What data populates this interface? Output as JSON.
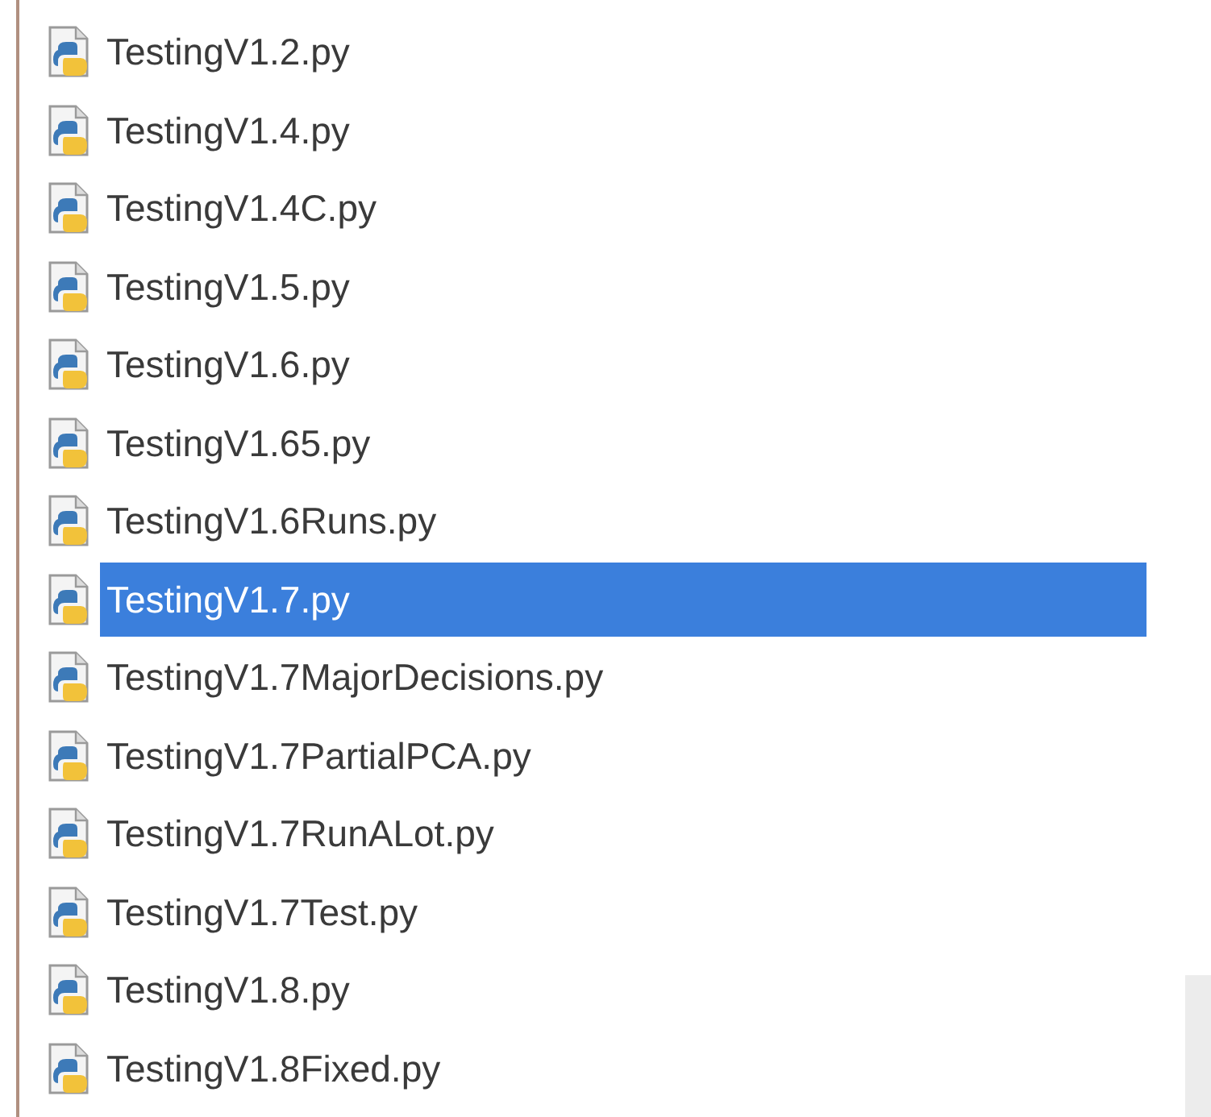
{
  "files": [
    {
      "name": "TestingV1.2.py",
      "selected": false
    },
    {
      "name": "TestingV1.4.py",
      "selected": false
    },
    {
      "name": "TestingV1.4C.py",
      "selected": false
    },
    {
      "name": "TestingV1.5.py",
      "selected": false
    },
    {
      "name": "TestingV1.6.py",
      "selected": false
    },
    {
      "name": "TestingV1.65.py",
      "selected": false
    },
    {
      "name": "TestingV1.6Runs.py",
      "selected": false
    },
    {
      "name": "TestingV1.7.py",
      "selected": true
    },
    {
      "name": "TestingV1.7MajorDecisions.py",
      "selected": false
    },
    {
      "name": "TestingV1.7PartialPCA.py",
      "selected": false
    },
    {
      "name": "TestingV1.7RunALot.py",
      "selected": false
    },
    {
      "name": "TestingV1.7Test.py",
      "selected": false
    },
    {
      "name": "TestingV1.8.py",
      "selected": false
    },
    {
      "name": "TestingV1.8Fixed.py",
      "selected": false
    }
  ]
}
